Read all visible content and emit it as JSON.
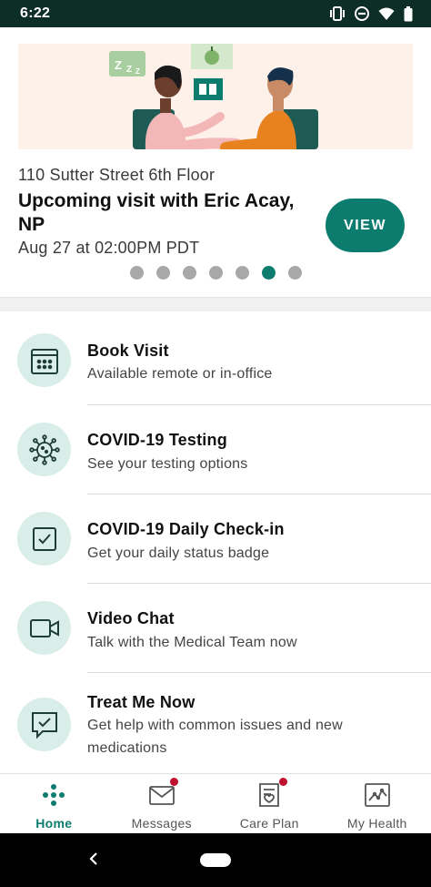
{
  "status_bar": {
    "time": "6:22",
    "icons": [
      "vibrate-icon",
      "do-not-disturb-icon",
      "wifi-icon",
      "battery-icon"
    ]
  },
  "visit_card": {
    "address": "110 Sutter Street 6th Floor",
    "title": "Upcoming visit with Eric Acay, NP",
    "time": "Aug 27 at 02:00PM PDT",
    "button_label": "VIEW",
    "page_count": 7,
    "active_page": 6,
    "accent_color": "#0c7c6f"
  },
  "menu": {
    "items": [
      {
        "title": "Book Visit",
        "subtitle": "Available remote or in-office",
        "icon": "calendar-icon"
      },
      {
        "title": "COVID-19 Testing",
        "subtitle": "See your testing options",
        "icon": "virus-icon"
      },
      {
        "title": "COVID-19 Daily Check-in",
        "subtitle": "Get your daily status badge",
        "icon": "checkbox-icon"
      },
      {
        "title": "Video Chat",
        "subtitle": "Talk with the Medical Team now",
        "icon": "video-camera-icon"
      },
      {
        "title": "Treat Me Now",
        "subtitle": "Get help with common issues and new medications",
        "icon": "chat-check-icon"
      }
    ]
  },
  "tabs": [
    {
      "label": "Home",
      "icon": "home-dots-icon",
      "active": true,
      "badge": false
    },
    {
      "label": "Messages",
      "icon": "envelope-icon",
      "active": false,
      "badge": true
    },
    {
      "label": "Care Plan",
      "icon": "care-plan-icon",
      "active": false,
      "badge": true
    },
    {
      "label": "My Health",
      "icon": "health-chart-icon",
      "active": false,
      "badge": false
    }
  ],
  "colors": {
    "accent": "#0c7c6f",
    "icon_bg": "#d9eee9",
    "badge": "#c0102f",
    "status_bar": "#0d2e26"
  }
}
